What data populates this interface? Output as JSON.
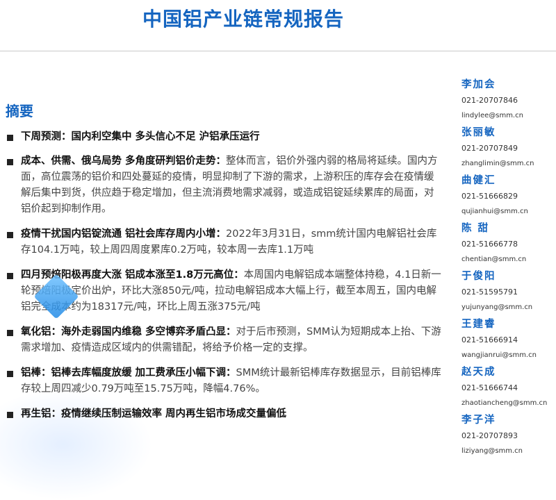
{
  "report": {
    "title": "中国铝产业链常规报告"
  },
  "summary": {
    "heading": "摘要",
    "items": [
      {
        "lead": "下周预测：国内利空集中 多头信心不足 沪铝承压运行",
        "body": ""
      },
      {
        "lead": "成本、供需、俄乌局势 多角度研判铝价走势：",
        "body": "整体而言，铝价外强内弱的格局将延续。国内方面，高位震荡的铝价和四处蔓延的疫情，明显抑制了下游的需求，上游积压的库存会在疫情缓解后集中到货，供应趋于稳定增加，但主流消费地需求减弱，或造成铝锭延续累库的局面，对铝价起到抑制作用。"
      },
      {
        "lead": "疫情干扰国内铝锭流通 铝社会库存周内小增：",
        "body": "2022年3月31日，smm统计国内电解铝社会库存104.1万吨，较上周四周度累库0.2万吨，较本周一去库1.1万吨"
      },
      {
        "lead": "四月预焙阳极再度大涨 铝成本涨至1.8万元高位：",
        "body": "本周国内电解铝成本端整体持稳，4.1日新一轮预焙阳极定价出炉，环比大涨850元/吨，拉动电解铝成本大幅上行，截至本周五，国内电解铝完全成本约为18317元/吨，环比上周五涨375元/吨"
      },
      {
        "lead": "氧化铝：海外走弱国内维稳 多空博弈矛盾凸显：",
        "body": "对于后市预测，SMM认为短期成本上抬、下游需求增加、疫情造成区域内的供需错配，将给予价格一定的支撑。"
      },
      {
        "lead": "铝棒：铝棒去库幅度放缓 加工费承压小幅下调：",
        "body": "SMM统计最新铝棒库存数据显示，目前铝棒库存较上周四减少0.79万吨至15.75万吨，降幅4.76%。"
      },
      {
        "lead": "再生铝：疫情继续压制运输效率 周内再生铝市场成交量偏低",
        "body": ""
      }
    ]
  },
  "contacts": [
    {
      "name": "李加会",
      "phone": "021-20707846",
      "email": "lindylee@smm.cn"
    },
    {
      "name": "张丽敏",
      "phone": "021-20707849",
      "email": "zhanglimin@smm.cn"
    },
    {
      "name": "曲健汇",
      "phone": "021-51666829",
      "email": "qujianhui@smm.cn"
    },
    {
      "name": "陈 甜",
      "phone": "021-51666778",
      "email": "chentian@smm.cn"
    },
    {
      "name": "于俊阳",
      "phone": "021-51595791",
      "email": "yujunyang@smm.cn"
    },
    {
      "name": "王建睿",
      "phone": "021-51666914",
      "email": "wangjianrui@smm.cn"
    },
    {
      "name": "赵天成",
      "phone": "021-51666744",
      "email": "zhaotiancheng@smm.cn"
    },
    {
      "name": "李子洋",
      "phone": "021-20707893",
      "email": "liziyang@smm.cn"
    }
  ],
  "colors": {
    "accent": "#1565c0",
    "text": "#444444",
    "lead_text": "#111111"
  }
}
